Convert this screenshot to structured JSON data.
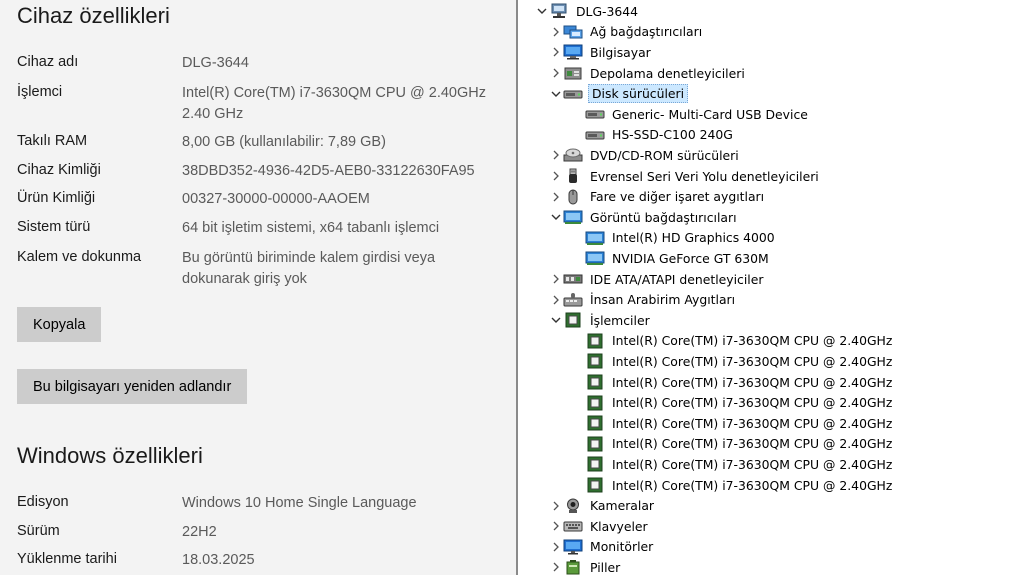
{
  "device_specs": {
    "title": "Cihaz özellikleri",
    "rows": [
      {
        "label": "Cihaz adı",
        "value": [
          "DLG-3644"
        ]
      },
      {
        "label": "İşlemci",
        "value": [
          "Intel(R) Core(TM) i7-3630QM CPU @ 2.40GHz",
          "2.40 GHz"
        ]
      },
      {
        "label": "Takılı RAM",
        "value": [
          "8,00 GB (kullanılabilir: 7,89 GB)"
        ]
      },
      {
        "label": "Cihaz Kimliği",
        "value": [
          "38DBD352-4936-42D5-AEB0-33122630FA95"
        ]
      },
      {
        "label": "Ürün Kimliği",
        "value": [
          "00327-30000-00000-AAOEM"
        ]
      },
      {
        "label": "Sistem türü",
        "value": [
          "64 bit işletim sistemi, x64 tabanlı işlemci"
        ]
      },
      {
        "label": "Kalem ve dokunma",
        "value": [
          "Bu görüntü biriminde kalem girdisi veya",
          "dokunarak giriş yok"
        ]
      }
    ],
    "copy_button": "Kopyala",
    "rename_button": "Bu bilgisayarı yeniden adlandır"
  },
  "windows_specs": {
    "title": "Windows özellikleri",
    "rows": [
      {
        "label": "Edisyon",
        "value": [
          "Windows 10 Home Single Language"
        ]
      },
      {
        "label": "Sürüm",
        "value": [
          "22H2"
        ]
      },
      {
        "label": "Yüklenme tarihi",
        "value": [
          "18.03.2025"
        ]
      }
    ]
  },
  "device_tree": {
    "root": "DLG-3644",
    "nodes": [
      {
        "label": "Ağ bağdaştırıcıları",
        "icon": "network-adapter-icon",
        "depth": 1,
        "state": "collapsed"
      },
      {
        "label": "Bilgisayar",
        "icon": "computer-icon",
        "depth": 1,
        "state": "collapsed"
      },
      {
        "label": "Depolama denetleyicileri",
        "icon": "storage-controller-icon",
        "depth": 1,
        "state": "collapsed"
      },
      {
        "label": "Disk sürücüleri",
        "icon": "disk-drive-icon",
        "depth": 1,
        "state": "expanded",
        "selected": true
      },
      {
        "label": "Generic- Multi-Card USB Device",
        "icon": "disk-drive-icon",
        "depth": 2,
        "state": "leaf"
      },
      {
        "label": "HS-SSD-C100 240G",
        "icon": "disk-drive-icon",
        "depth": 2,
        "state": "leaf"
      },
      {
        "label": "DVD/CD-ROM sürücüleri",
        "icon": "dvd-drive-icon",
        "depth": 1,
        "state": "collapsed"
      },
      {
        "label": "Evrensel Seri Veri Yolu denetleyicileri",
        "icon": "usb-icon",
        "depth": 1,
        "state": "collapsed"
      },
      {
        "label": "Fare ve diğer işaret aygıtları",
        "icon": "mouse-icon",
        "depth": 1,
        "state": "collapsed"
      },
      {
        "label": "Görüntü bağdaştırıcıları",
        "icon": "display-adapter-icon",
        "depth": 1,
        "state": "expanded"
      },
      {
        "label": "Intel(R) HD Graphics 4000",
        "icon": "display-adapter-icon",
        "depth": 2,
        "state": "leaf"
      },
      {
        "label": "NVIDIA GeForce GT 630M",
        "icon": "display-adapter-icon",
        "depth": 2,
        "state": "leaf"
      },
      {
        "label": "IDE ATA/ATAPI denetleyiciler",
        "icon": "ide-controller-icon",
        "depth": 1,
        "state": "collapsed"
      },
      {
        "label": "İnsan Arabirim Aygıtları",
        "icon": "hid-icon",
        "depth": 1,
        "state": "collapsed"
      },
      {
        "label": "İşlemciler",
        "icon": "processor-icon",
        "depth": 1,
        "state": "expanded"
      },
      {
        "label": "Intel(R) Core(TM) i7-3630QM CPU @ 2.40GHz",
        "icon": "processor-icon",
        "depth": 2,
        "state": "leaf"
      },
      {
        "label": "Intel(R) Core(TM) i7-3630QM CPU @ 2.40GHz",
        "icon": "processor-icon",
        "depth": 2,
        "state": "leaf"
      },
      {
        "label": "Intel(R) Core(TM) i7-3630QM CPU @ 2.40GHz",
        "icon": "processor-icon",
        "depth": 2,
        "state": "leaf"
      },
      {
        "label": "Intel(R) Core(TM) i7-3630QM CPU @ 2.40GHz",
        "icon": "processor-icon",
        "depth": 2,
        "state": "leaf"
      },
      {
        "label": "Intel(R) Core(TM) i7-3630QM CPU @ 2.40GHz",
        "icon": "processor-icon",
        "depth": 2,
        "state": "leaf"
      },
      {
        "label": "Intel(R) Core(TM) i7-3630QM CPU @ 2.40GHz",
        "icon": "processor-icon",
        "depth": 2,
        "state": "leaf"
      },
      {
        "label": "Intel(R) Core(TM) i7-3630QM CPU @ 2.40GHz",
        "icon": "processor-icon",
        "depth": 2,
        "state": "leaf"
      },
      {
        "label": "Intel(R) Core(TM) i7-3630QM CPU @ 2.40GHz",
        "icon": "processor-icon",
        "depth": 2,
        "state": "leaf"
      },
      {
        "label": "Kameralar",
        "icon": "camera-icon",
        "depth": 1,
        "state": "collapsed"
      },
      {
        "label": "Klavyeler",
        "icon": "keyboard-icon",
        "depth": 1,
        "state": "collapsed"
      },
      {
        "label": "Monitörler",
        "icon": "monitor-icon",
        "depth": 1,
        "state": "collapsed"
      },
      {
        "label": "Piller",
        "icon": "battery-icon",
        "depth": 1,
        "state": "collapsed"
      }
    ]
  },
  "colors": {
    "settings_bg": "#f3f3f3",
    "button_bg": "#cccccc",
    "selection_bg": "#cce8ff",
    "label_text": "#1a1a1a",
    "value_text": "#5a5a5a"
  }
}
